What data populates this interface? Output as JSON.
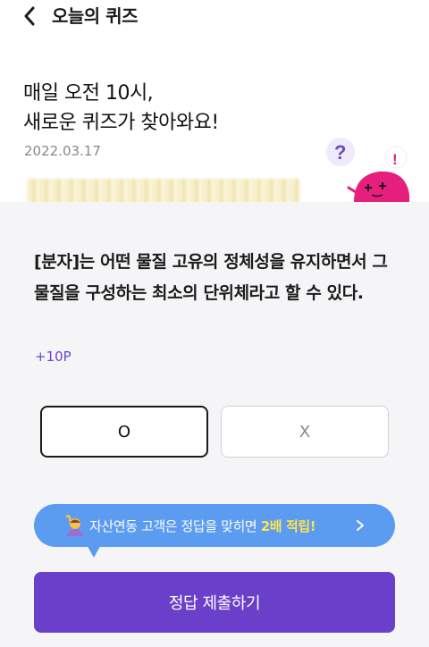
{
  "header": {
    "title": "오늘의 퀴즈",
    "back_icon": "chevron-left-icon"
  },
  "hero": {
    "headline_line1": "매일 오전 10시,",
    "headline_line2": "새로운 퀴즈가 찾아와요!",
    "date": "2022.03.17",
    "mascot_icon": "quiz-mascot-icon"
  },
  "quiz": {
    "question": "[분자]는 어떤 물질 고유의 정체성을 유지하면서 그 물질을 구성하는 최소의 단위체라고 할 수 있다.",
    "points": "+10P",
    "options": [
      {
        "label": "O",
        "selected": true
      },
      {
        "label": "X",
        "selected": false
      }
    ]
  },
  "banner": {
    "icon": "person-raising-hand-icon",
    "text": "자산연동 고객은 정답을 맞히면 ",
    "emphasis": "2배 적립!",
    "chevron_icon": "chevron-right-icon"
  },
  "submit": {
    "label": "정답 제출하기"
  },
  "colors": {
    "accent": "#6a3fc9",
    "points": "#6b46c8",
    "banner": "#5b9bf0",
    "banner_emphasis": "#ffe34a",
    "background_lower": "#f5f5f7"
  }
}
